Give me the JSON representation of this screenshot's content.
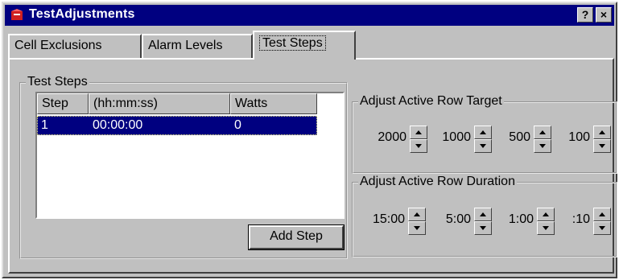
{
  "window": {
    "title": "TestAdjustments",
    "help_label": "?",
    "close_label": "×"
  },
  "tabs": [
    {
      "label": "Cell Exclusions"
    },
    {
      "label": "Alarm Levels"
    },
    {
      "label": "Test Steps",
      "active": true
    }
  ],
  "steps_group": {
    "legend": "Test Steps",
    "columns": [
      "Step",
      "(hh:mm:ss)",
      "Watts"
    ],
    "rows": [
      {
        "step": "1",
        "time": "00:00:00",
        "watts": "0",
        "selected": true
      }
    ],
    "add_label": "Add Step"
  },
  "target_group": {
    "legend": "Adjust Active Row Target",
    "spinners": [
      {
        "label": "2000"
      },
      {
        "label": "1000"
      },
      {
        "label": "500"
      },
      {
        "label": "100"
      }
    ]
  },
  "duration_group": {
    "legend": "Adjust Active Row Duration",
    "spinners": [
      {
        "label": "15:00"
      },
      {
        "label": "5:00"
      },
      {
        "label": "1:00"
      },
      {
        "label": ":10"
      }
    ]
  },
  "icons": {
    "app": "app-icon",
    "spin_up": "arrow-up-icon",
    "spin_down": "arrow-down-icon"
  },
  "colors": {
    "titlebar": "#000080",
    "selection": "#000080",
    "face": "#c0c0c0"
  }
}
